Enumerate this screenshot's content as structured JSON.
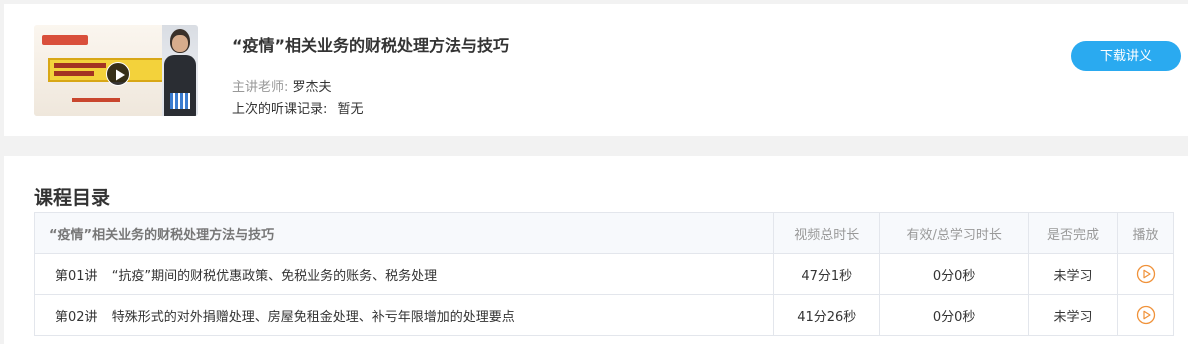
{
  "course": {
    "title": "“疫情”相关业务的财税处理方法与技巧",
    "teacher_label": "主讲老师:",
    "teacher_name": "罗杰夫",
    "last_record_label": "上次的听课记录:",
    "last_record_value": "暂无",
    "download_label": "下载讲义"
  },
  "catalog": {
    "section_title": "课程目录",
    "columns": {
      "name": "“疫情”相关业务的财税处理方法与技巧",
      "video_duration": "视频总时长",
      "study_duration": "有效/总学习时长",
      "completed": "是否完成",
      "play": "播放"
    },
    "rows": [
      {
        "no": "第01讲",
        "title": "“抗疫”期间的财税优惠政策、免税业务的账务、税务处理",
        "video_duration": "47分1秒",
        "study_duration": "0分0秒",
        "status": "未学习"
      },
      {
        "no": "第02讲",
        "title": "特殊形式的对外捐赠处理、房屋免租金处理、补亏年限增加的处理要点",
        "video_duration": "41分26秒",
        "study_duration": "0分0秒",
        "status": "未学习"
      }
    ]
  },
  "colors": {
    "accent": "#2aaaf0",
    "status_green": "#3bb54a",
    "play_orange": "#f0923a"
  },
  "icons": {
    "thumbnail_play": "play-icon",
    "row_play": "play-circle-icon"
  }
}
